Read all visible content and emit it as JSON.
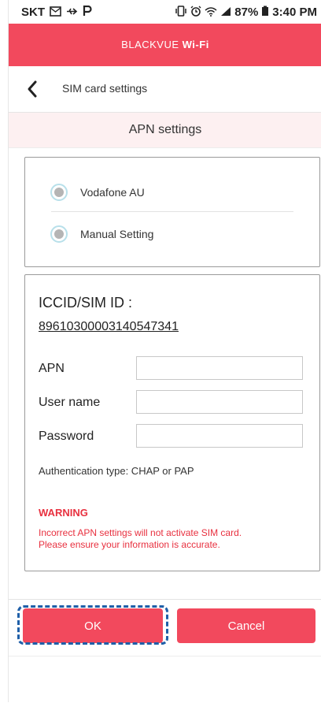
{
  "statusbar": {
    "carrier": "SKT",
    "battery": "87%",
    "time": "3:40 PM",
    "left_icons": [
      "mail-icon",
      "usb-icon",
      "p-icon"
    ],
    "right_icons": [
      "vibrate-icon",
      "alarm-icon",
      "wifi-icon",
      "signal-icon",
      "battery-icon"
    ]
  },
  "app": {
    "title_regular": "BLACKVUE ",
    "title_bold": "Wi-Fi",
    "accent_color": "#f2495d"
  },
  "nav": {
    "title": "SIM card settings",
    "back_icon": "chevron-left-icon"
  },
  "section": {
    "title": "APN settings"
  },
  "apn_options": [
    {
      "label": "Vodafone AU"
    },
    {
      "label": "Manual Setting"
    }
  ],
  "sim": {
    "iccid_label": "ICCID/SIM ID :",
    "iccid_value": "89610300003140547341",
    "fields": [
      {
        "label": "APN",
        "value": ""
      },
      {
        "label": "User name",
        "value": ""
      },
      {
        "label": "Password",
        "value": ""
      }
    ],
    "auth_text": "Authentication type: CHAP or PAP",
    "warning_title": "WARNING",
    "warning_line1": "Incorrect APN settings will not activate SIM card.",
    "warning_line2": "Please ensure your information is accurate.",
    "warning_color": "#e8303f"
  },
  "buttons": {
    "ok": "OK",
    "cancel": "Cancel"
  }
}
